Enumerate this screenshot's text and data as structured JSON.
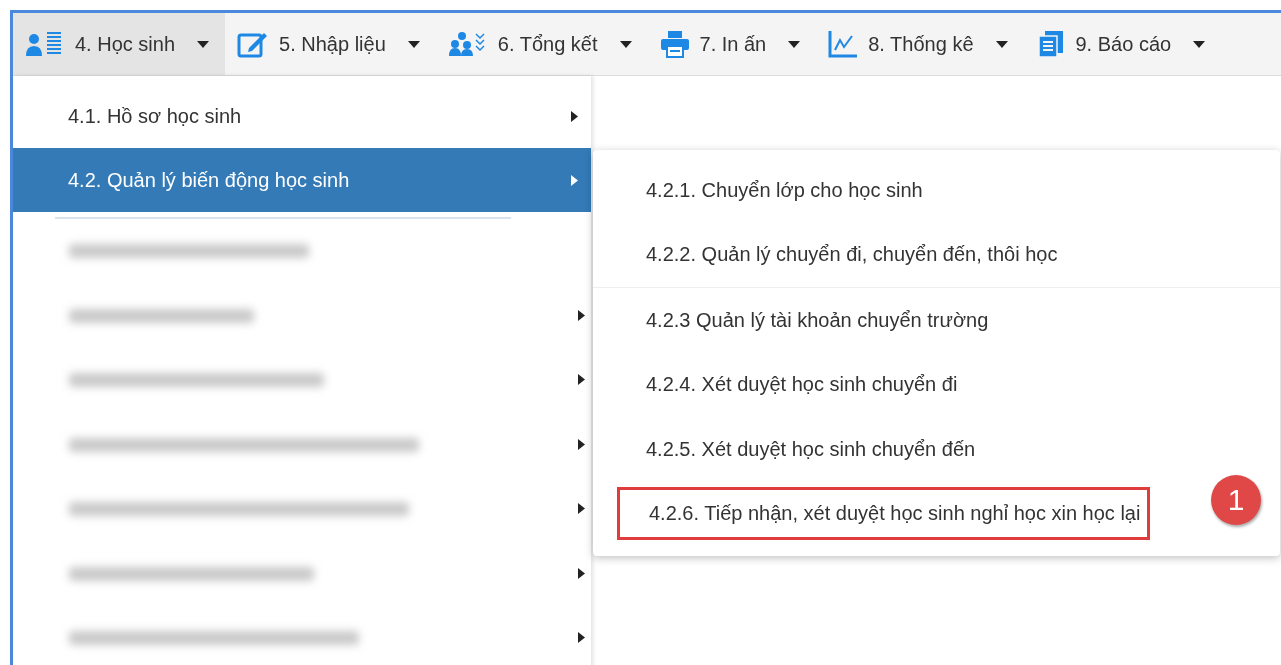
{
  "menu_bar": [
    {
      "label": "4. Học sinh",
      "kind": "students",
      "selected": true
    },
    {
      "label": "5. Nhập liệu",
      "kind": "edit",
      "selected": false
    },
    {
      "label": "6. Tổng kết",
      "kind": "group",
      "selected": false
    },
    {
      "label": "7. In ấn",
      "kind": "print",
      "selected": false
    },
    {
      "label": "8. Thống kê",
      "kind": "chart",
      "selected": false
    },
    {
      "label": "9. Báo cáo",
      "kind": "docs",
      "selected": false
    }
  ],
  "dropdown": {
    "items": [
      {
        "label": "4.1. Hồ sơ học sinh",
        "selected": false
      },
      {
        "label": "4.2. Quản lý biến động học sinh",
        "selected": true
      }
    ],
    "blurred_items": [
      {
        "has_submenu": false
      },
      {
        "has_submenu": true
      },
      {
        "has_submenu": true
      },
      {
        "has_submenu": true
      },
      {
        "has_submenu": true
      },
      {
        "has_submenu": true
      },
      {
        "has_submenu": true
      }
    ]
  },
  "submenu": {
    "items": [
      {
        "kind": "item",
        "label": "4.2.1. Chuyển lớp cho học sinh",
        "highlighted": false
      },
      {
        "kind": "item",
        "label": "4.2.2. Quản lý chuyển đi, chuyển đến, thôi học",
        "highlighted": false
      },
      {
        "kind": "divider"
      },
      {
        "kind": "item",
        "label": "4.2.3 Quản lý tài khoản chuyển trường",
        "highlighted": false
      },
      {
        "kind": "item",
        "label": "4.2.4. Xét duyệt học sinh chuyển đi",
        "highlighted": false
      },
      {
        "kind": "item",
        "label": "4.2.5. Xét duyệt học sinh chuyển đến",
        "highlighted": false
      },
      {
        "kind": "item",
        "label": "4.2.6. Tiếp nhận, xét duyệt học sinh nghỉ học xin học lại",
        "highlighted": true
      }
    ]
  },
  "callout": {
    "number": "1"
  }
}
